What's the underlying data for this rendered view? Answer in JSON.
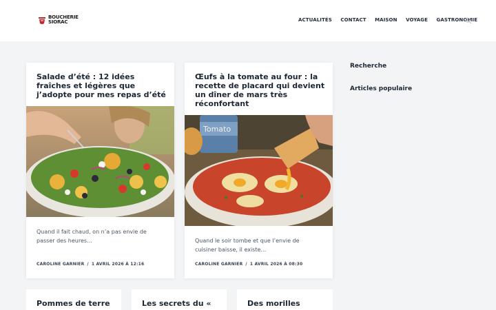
{
  "header": {
    "logo_line1": "BOUCHERIE",
    "logo_line2": "SIORAC",
    "nav": [
      "ACTUALITÉS",
      "CONTACT",
      "MAISON",
      "VOYAGE",
      "GASTRONOMIE"
    ]
  },
  "posts": [
    {
      "title": "Salade d’été : 12 idées fraîches et légères que j’adopte pour mes repas d’été",
      "excerpt": "Quand il fait chaud, on n’a pas envie de passer des heures…",
      "author": "CAROLINE GARNIER",
      "date": "1 AVRIL 2026 À 12:16"
    },
    {
      "title": "Œufs à la tomate au four : la recette de placard qui devient un dîner de mars très réconfortant",
      "excerpt": "Quand le soir tombe et que l’envie de cuisiner baisse, il existe…",
      "author": "CAROLINE GARNIER",
      "date": "1 AVRIL 2026 À 08:30",
      "image_label": "Tomato"
    }
  ],
  "more_posts": [
    {
      "title": "Pommes de terre"
    },
    {
      "title": "Les secrets du «"
    },
    {
      "title": "Des morilles"
    }
  ],
  "meta_separator": "/",
  "sidebar": {
    "search_title": "Recherche",
    "popular_title": "Articles populaire"
  },
  "colors": {
    "background": "#f2f4f6",
    "brand_red": "#c0282d",
    "text": "#1c2733"
  }
}
